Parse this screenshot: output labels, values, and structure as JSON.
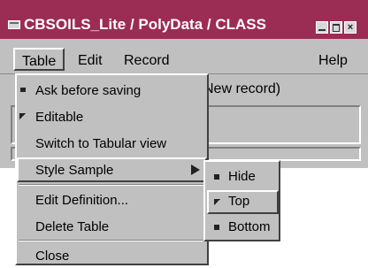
{
  "window": {
    "title": "CBSOILS_Lite / PolyData / CLASS",
    "close_glyph": "×"
  },
  "menubar": {
    "items": [
      {
        "label": "Table"
      },
      {
        "label": "Edit"
      },
      {
        "label": "Record"
      },
      {
        "label": "Help"
      }
    ]
  },
  "status": {
    "text": "New record)"
  },
  "table_menu": {
    "items": [
      {
        "label": "Ask before saving"
      },
      {
        "label": "Editable"
      },
      {
        "label": "Switch to Tabular view"
      },
      {
        "label": "Style Sample"
      },
      {
        "label": "Edit Definition..."
      },
      {
        "label": "Delete Table"
      },
      {
        "label": "Close"
      }
    ]
  },
  "style_submenu": {
    "items": [
      {
        "label": "Hide"
      },
      {
        "label": "Top"
      },
      {
        "label": "Bottom"
      }
    ]
  },
  "colors": {
    "titlebar": "#9b2c53",
    "face": "#c0c0c0"
  }
}
